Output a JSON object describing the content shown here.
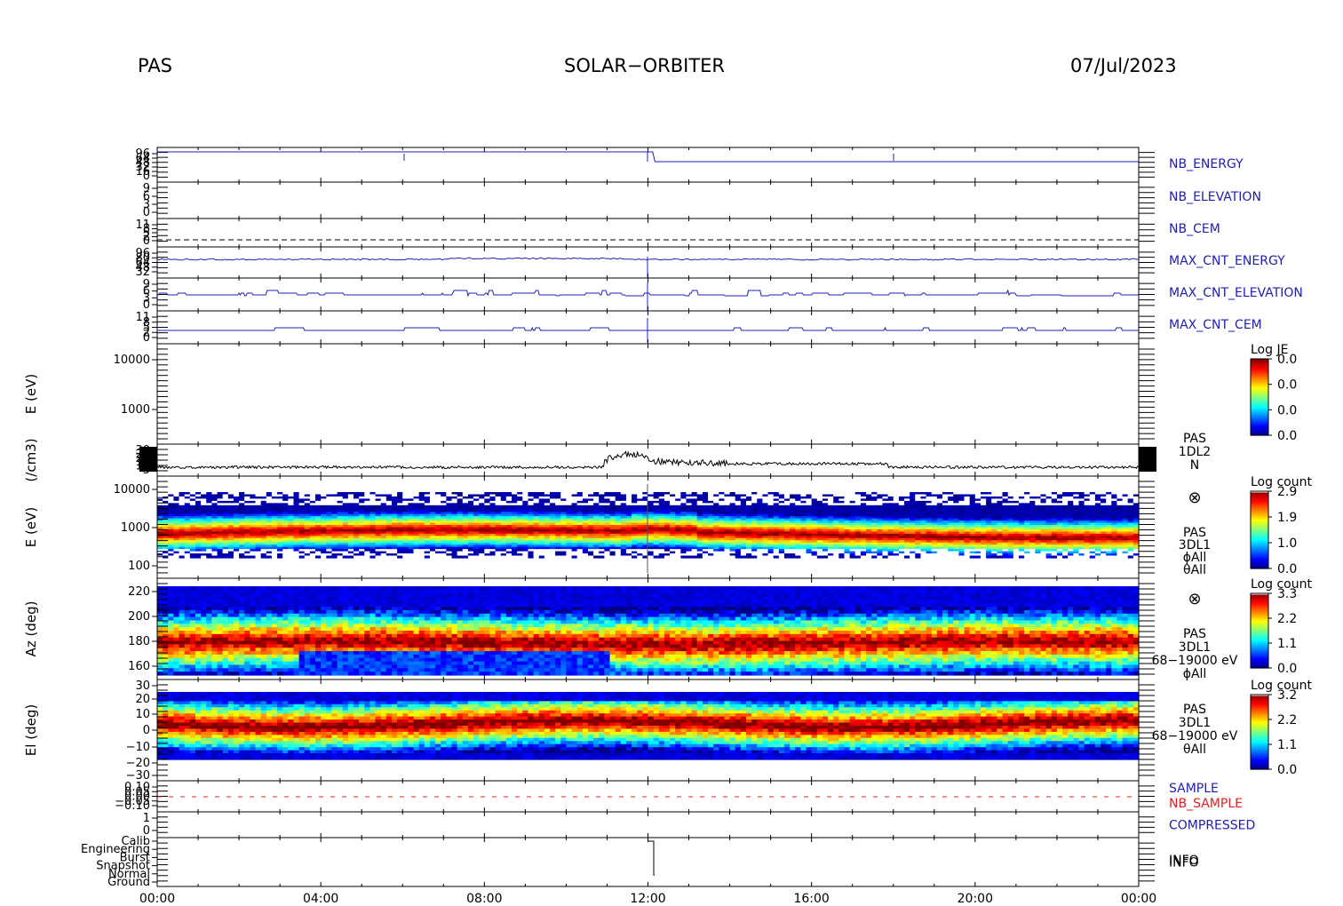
{
  "header": {
    "instrument": "PAS",
    "mission": "SOLAR−ORBITER",
    "date": "07/Jul/2023"
  },
  "chart_data": {
    "type": "heatmap",
    "x_ticks": [
      "00:00",
      "04:00",
      "08:00",
      "12:00",
      "16:00",
      "20:00",
      "00:00"
    ],
    "panels": [
      {
        "id": "nb-energy",
        "label": "NB_ENERGY",
        "label_color": "#2020b0",
        "y_ticks": [
          "96",
          "64",
          "48",
          "32",
          "16",
          "0"
        ]
      },
      {
        "id": "nb-elevation",
        "label": "NB_ELEVATION",
        "label_color": "#2020b0",
        "y_ticks": [
          "9",
          "6",
          "3",
          "0"
        ]
      },
      {
        "id": "nb-cem",
        "label": "NB_CEM",
        "label_color": "#2020b0",
        "y_ticks": [
          "11",
          "8",
          "5",
          "2",
          "0"
        ]
      },
      {
        "id": "max-cnt-energy",
        "label": "MAX_CNT_ENERGY",
        "label_color": "#2020b0",
        "y_ticks": [
          "96",
          "80",
          "64",
          "48",
          "32"
        ]
      },
      {
        "id": "max-cnt-elevation",
        "label": "MAX_CNT_ELEVATION",
        "label_color": "#2020b0",
        "y_ticks": [
          "9",
          "6",
          "3",
          "0"
        ]
      },
      {
        "id": "max-cnt-cem",
        "label": "MAX_CNT_CEM",
        "label_color": "#2020b0",
        "y_ticks": [
          "11",
          "8",
          "5",
          "2",
          "0"
        ]
      },
      {
        "id": "je-spectrogram",
        "ylabel": "E (eV)",
        "y_ticks": [
          "10000",
          "1000"
        ],
        "cbar_title": "Log JE",
        "cbar_ticks": [
          "0.0",
          "0.0",
          "0.0",
          "0.0"
        ]
      },
      {
        "id": "density",
        "ylabel": "(/cm3)",
        "y_ticks": [
          "30",
          "25",
          "20",
          "15",
          "10",
          "5"
        ],
        "side_lines": [
          "PAS",
          "1DL2",
          "N"
        ]
      },
      {
        "id": "energy-spectrogram",
        "ylabel": "E (eV)",
        "y_ticks": [
          "10000",
          "1000",
          "100"
        ],
        "cbar_title": "Log count",
        "cbar_ticks": [
          "2.9",
          "1.9",
          "1.0",
          "0.0"
        ],
        "side_lines": [
          "PAS",
          "3DL1",
          "ϕAll",
          "θAll"
        ]
      },
      {
        "id": "azimuth-spectrogram",
        "ylabel": "Az (deg)",
        "y_ticks": [
          "220",
          "200",
          "180",
          "160"
        ],
        "cbar_title": "Log count",
        "cbar_ticks": [
          "3.3",
          "2.2",
          "1.1",
          "0.0"
        ],
        "side_lines": [
          "PAS",
          "3DL1",
          "68−19000 eV",
          "ϕAll"
        ]
      },
      {
        "id": "elevation-spectrogram",
        "ylabel": "El (deg)",
        "y_ticks": [
          "30",
          "20",
          "10",
          "0",
          "−10",
          "−20",
          "−30"
        ],
        "cbar_title": "Log count",
        "cbar_ticks": [
          "3.2",
          "2.2",
          "1.1",
          "0.0"
        ],
        "side_lines": [
          "PAS",
          "3DL1",
          "68−19000 eV",
          "θAll"
        ]
      },
      {
        "id": "sample",
        "labels": [
          {
            "text": "SAMPLE",
            "color": "#2020b0"
          },
          {
            "text": "NB_SAMPLE",
            "color": "#e02020"
          }
        ],
        "y_ticks": [
          "0.10",
          "0.05",
          "0.00",
          "−0.05",
          "−0.10"
        ]
      },
      {
        "id": "compressed",
        "label": "COMPRESSED",
        "label_color": "#2020b0",
        "y_ticks": [
          "1",
          "0"
        ]
      },
      {
        "id": "info",
        "label": "INFO",
        "label_color": "#000000",
        "y_ticks": [
          "Calib",
          "Engineering",
          "Burst",
          "Snapshot",
          "Normal",
          "Ground"
        ]
      }
    ]
  }
}
